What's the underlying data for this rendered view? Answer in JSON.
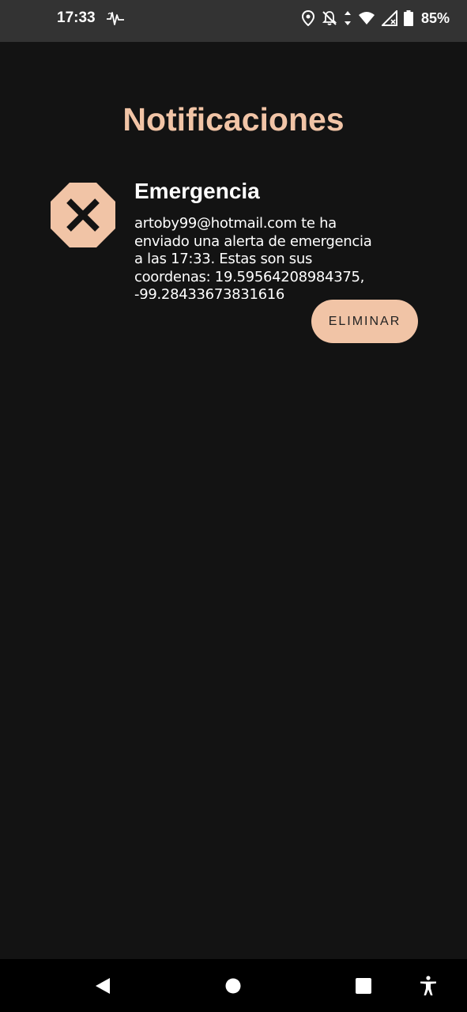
{
  "status_bar": {
    "time": "17:33",
    "battery_percent": "85%",
    "icons": [
      "pulse-icon",
      "location-icon",
      "notifications-off-icon",
      "data-arrows-icon",
      "wifi-icon",
      "signal-icon",
      "battery-icon"
    ]
  },
  "page": {
    "title": "Notificaciones"
  },
  "notification": {
    "title": "Emergencia",
    "body": "artoby99@hotmail.com te ha enviado una alerta de emergencia a las 17:33. Estas son sus coordenas: 19.59564208984375, -99.28433673831616",
    "icon": "emergency-stop-icon",
    "delete_label": "ELIMINAR"
  },
  "colors": {
    "accent": "#f1c4a6",
    "background": "#131313",
    "status_bar": "#333333",
    "nav_bar": "#000000"
  },
  "nav_bar": {
    "buttons": [
      "back-icon",
      "home-icon",
      "recents-icon",
      "accessibility-icon"
    ]
  }
}
